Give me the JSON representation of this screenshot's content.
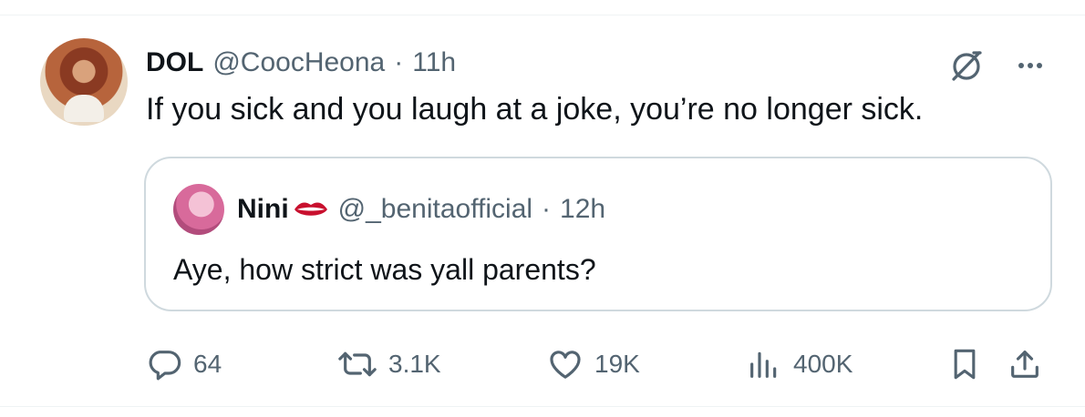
{
  "tweet": {
    "author": {
      "name": "DOL",
      "handle": "@CoocHeona",
      "time": "11h"
    },
    "text": "If you sick and you laugh at a joke, you’re no longer sick."
  },
  "quoted_tweet": {
    "author": {
      "name": "Nini",
      "emoji": "👄",
      "handle": "@_benitaofficial",
      "time": "12h"
    },
    "text": "Aye, how strict was yall parents?"
  },
  "actions": {
    "replies": "64",
    "reposts": "3.1K",
    "likes": "19K",
    "views": "400K"
  },
  "separator": "·",
  "icons": {
    "grok": "grok-icon",
    "more": "more-icon",
    "reply": "reply-icon",
    "repost": "repost-icon",
    "like": "heart-icon",
    "views": "views-icon",
    "bookmark": "bookmark-icon",
    "share": "share-icon"
  },
  "colors": {
    "text": "#0f1419",
    "secondary": "#536471",
    "border": "#cfd9de",
    "lips": "#c8102e"
  }
}
